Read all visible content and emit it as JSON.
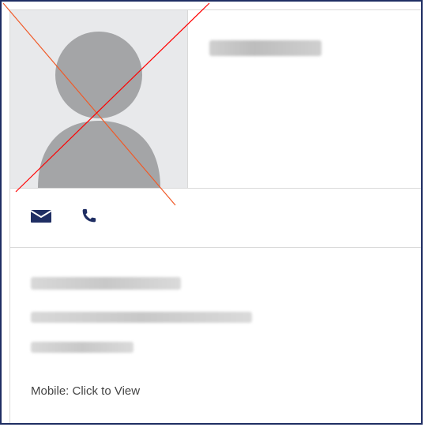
{
  "profile": {
    "mobile_label": "Mobile: Click to View"
  },
  "icons": {
    "email": "envelope-icon",
    "phone": "phone-icon",
    "avatar": "user-placeholder-icon"
  },
  "colors": {
    "frame": "#1f2e63",
    "icon": "#1f2e63",
    "border": "#d9d9d9",
    "avatar_bg": "#e8e9eb",
    "avatar_silhouette": "#a4a5a7",
    "overlay_line_1": "#f05a28",
    "overlay_line_2": "#ff0000"
  }
}
